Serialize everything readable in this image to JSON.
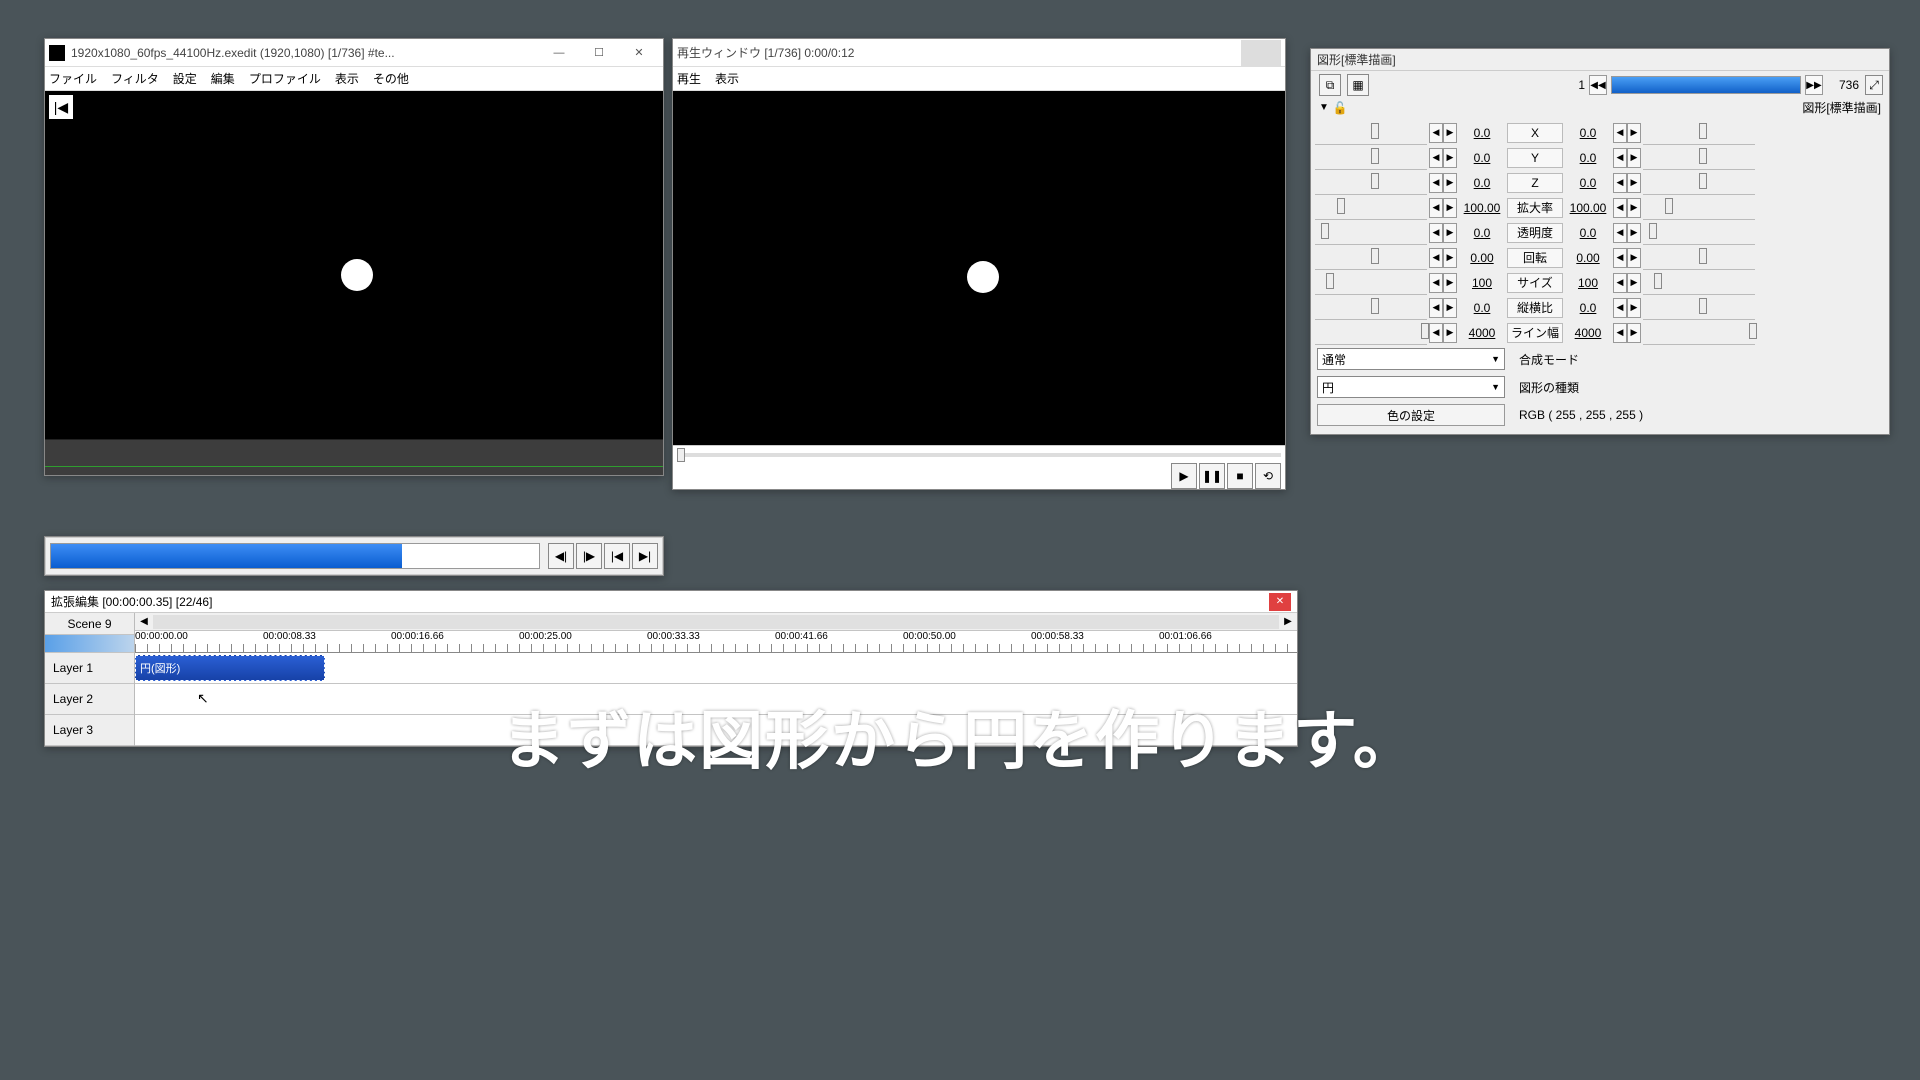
{
  "main_window": {
    "title": "1920x1080_60fps_44100Hz.exedit (1920,1080)  [1/736]  #te...",
    "menu": [
      "ファイル",
      "フィルタ",
      "設定",
      "編集",
      "プロファイル",
      "表示",
      "その他"
    ]
  },
  "playback_window": {
    "title": "再生ウィンドウ  [1/736]  0:00/0:12",
    "menu": [
      "再生",
      "表示"
    ]
  },
  "props": {
    "title": "図形[標準描画]",
    "section": "図形[標準描画]",
    "frame_start": "1",
    "frame_end": "736",
    "params": [
      {
        "label": "X",
        "l": "0.0",
        "r": "0.0",
        "lp": 50,
        "rp": 50
      },
      {
        "label": "Y",
        "l": "0.0",
        "r": "0.0",
        "lp": 50,
        "rp": 50
      },
      {
        "label": "Z",
        "l": "0.0",
        "r": "0.0",
        "lp": 50,
        "rp": 50
      },
      {
        "label": "拡大率",
        "l": "100.00",
        "r": "100.00",
        "lp": 20,
        "rp": 20
      },
      {
        "label": "透明度",
        "l": "0.0",
        "r": "0.0",
        "lp": 5,
        "rp": 5
      },
      {
        "label": "回転",
        "l": "0.00",
        "r": "0.00",
        "lp": 50,
        "rp": 50
      },
      {
        "label": "サイズ",
        "l": "100",
        "r": "100",
        "lp": 10,
        "rp": 10
      },
      {
        "label": "縦横比",
        "l": "0.0",
        "r": "0.0",
        "lp": 50,
        "rp": 50
      },
      {
        "label": "ライン幅",
        "l": "4000",
        "r": "4000",
        "lp": 95,
        "rp": 95
      }
    ],
    "blend_label": "合成モード",
    "blend_value": "通常",
    "shape_label": "図形の種類",
    "shape_value": "円",
    "color_btn": "色の設定",
    "color_value": "RGB ( 255 , 255 , 255 )"
  },
  "timeline": {
    "title": "拡張編集 [00:00:00.35] [22/46]",
    "scene": "Scene 9",
    "layers": [
      "Layer 1",
      "Layer 2",
      "Layer 3"
    ],
    "times": [
      "00:00:00.00",
      "00:00:08.33",
      "00:00:16.66",
      "00:00:25.00",
      "00:00:33.33",
      "00:00:41.66",
      "00:00:50.00",
      "00:00:58.33",
      "00:01:06.66"
    ],
    "clip": "円(図形)"
  },
  "subtitle": "まずは図形から円を作ります。"
}
